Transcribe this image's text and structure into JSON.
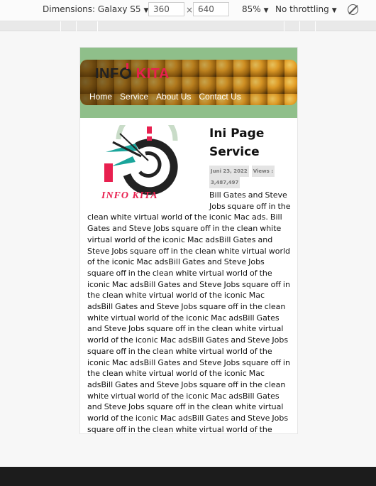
{
  "devtools": {
    "dimensions_label": "Dimensions: Galaxy S5",
    "width_value": "360",
    "height_value": "640",
    "times": "×",
    "zoom": "85%",
    "throttling": "No throttling"
  },
  "site": {
    "logo_info": "INF",
    "logo_kita": "KITA",
    "nav": [
      "Home",
      "Service",
      "About Us",
      "Contact Us"
    ]
  },
  "post": {
    "thumb_caption": "INFO KITA",
    "title": "Ini Page Service",
    "date": "Juni 23, 2022",
    "views_label": "Views :",
    "views_value": "3,487,497",
    "body": "Bill Gates and Steve Jobs square off in the clean white virtual world of the iconic Mac ads. Bill Gates and Steve Jobs square off in the clean white virtual world of the iconic Mac adsBill Gates and Steve Jobs square off in the clean white virtual world of the iconic Mac adsBill Gates and Steve Jobs square off in the clean white virtual world of the iconic Mac adsBill Gates and Steve Jobs square off in the clean white virtual world of the iconic Mac adsBill Gates and Steve Jobs square off in the clean white virtual world of the iconic Mac adsBill Gates and Steve Jobs square off in the clean white virtual world of the iconic Mac adsBill Gates and Steve Jobs square off in the clean white virtual world of the iconic Mac adsBill Gates and Steve Jobs square off in the clean white virtual world of the iconic Mac adsBill Gates and Steve Jobs square off in the clean white virtual world of the iconic Mac adsBill Gates and Steve Jobs square off in the clean white virtual world of the iconic Mac adsBill Gates and Steve Jobs square off in the clean white virtual world of the iconic Mac adsBill Gates and Steve Jobs square off in the clean white virtual world of the iconic Mac adsBill Gates and Steve Jobs square off in the clean white virtual world of the iconic Mac adsBill Gates and Steve Jobs square off in the clean white virtual world of the iconic Mac ads"
  },
  "colors": {
    "header_green": "#8fbf8a",
    "brand_pink": "#e8204f",
    "teal": "#1aa59b"
  }
}
